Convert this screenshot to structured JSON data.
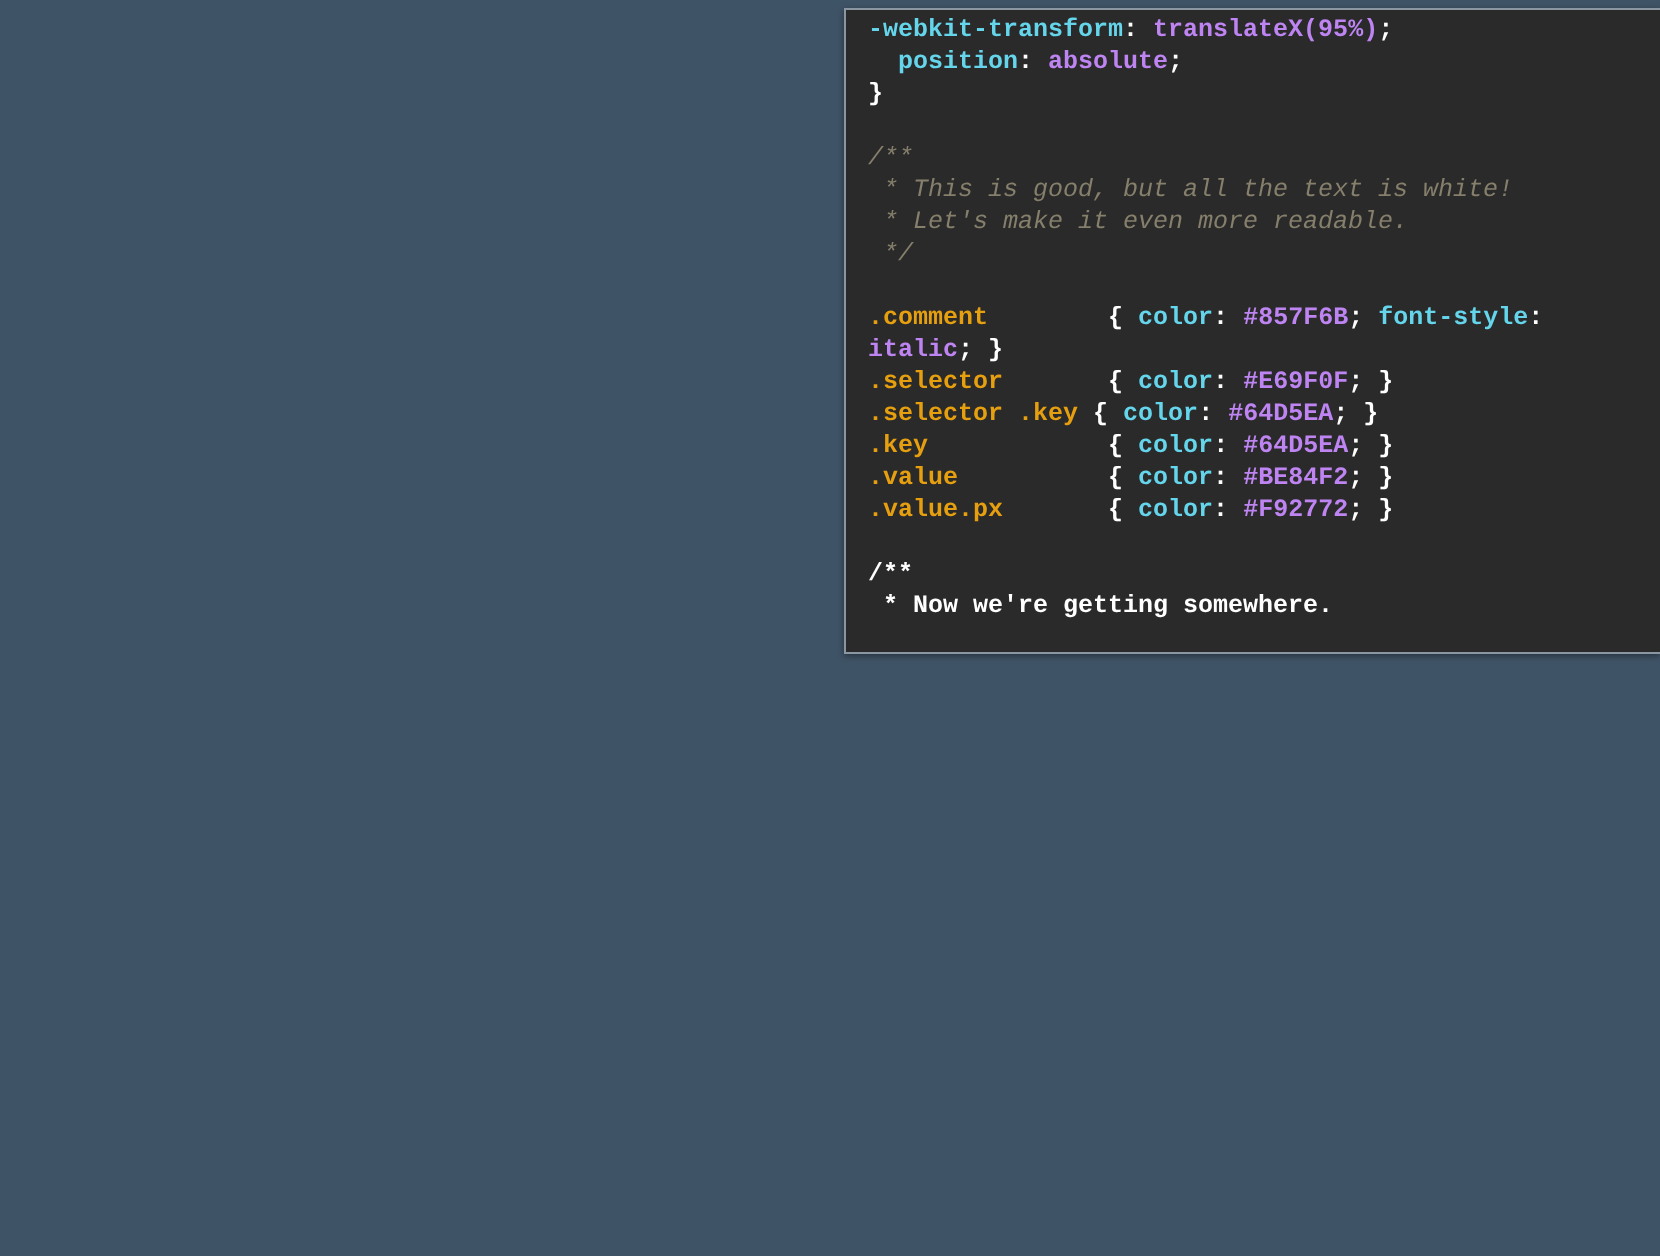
{
  "code_panel": {
    "lines": [
      {
        "blank_before": false,
        "tokens": [
          {
            "kind": "key",
            "text": "-webkit-transform"
          },
          {
            "kind": "plain",
            "text": ": "
          },
          {
            "kind": "value",
            "text": "translateX(95%)"
          },
          {
            "kind": "plain",
            "text": ";"
          }
        ]
      },
      {
        "blank_before": false,
        "tokens": [
          {
            "kind": "key",
            "text": "  position"
          },
          {
            "kind": "plain",
            "text": ": "
          },
          {
            "kind": "value",
            "text": "absolute"
          },
          {
            "kind": "plain",
            "text": ";"
          }
        ]
      },
      {
        "blank_before": false,
        "tokens": [
          {
            "kind": "plain",
            "text": "}"
          }
        ]
      },
      {
        "blank_before": true,
        "tokens": [
          {
            "kind": "comment",
            "text": "/**"
          }
        ]
      },
      {
        "blank_before": false,
        "tokens": [
          {
            "kind": "comment",
            "text": " * This is good, but all the text is white!"
          }
        ]
      },
      {
        "blank_before": false,
        "tokens": [
          {
            "kind": "comment",
            "text": " * Let's make it even more readable."
          }
        ]
      },
      {
        "blank_before": false,
        "tokens": [
          {
            "kind": "comment",
            "text": " */"
          }
        ]
      },
      {
        "blank_before": true,
        "tokens": [
          {
            "kind": "selector",
            "text": ".comment"
          },
          {
            "kind": "plain",
            "text": "        { "
          },
          {
            "kind": "key",
            "text": "color"
          },
          {
            "kind": "plain",
            "text": ": "
          },
          {
            "kind": "value",
            "text": "#857F6B"
          },
          {
            "kind": "plain",
            "text": "; "
          },
          {
            "kind": "key",
            "text": "font-style"
          },
          {
            "kind": "plain",
            "text": ":"
          }
        ]
      },
      {
        "blank_before": false,
        "tokens": [
          {
            "kind": "value",
            "text": "italic"
          },
          {
            "kind": "plain",
            "text": "; }"
          }
        ]
      },
      {
        "blank_before": false,
        "tokens": [
          {
            "kind": "selector",
            "text": ".selector"
          },
          {
            "kind": "plain",
            "text": "       { "
          },
          {
            "kind": "key",
            "text": "color"
          },
          {
            "kind": "plain",
            "text": ": "
          },
          {
            "kind": "value",
            "text": "#E69F0F"
          },
          {
            "kind": "plain",
            "text": "; }"
          }
        ]
      },
      {
        "blank_before": false,
        "tokens": [
          {
            "kind": "selector",
            "text": ".selector .key"
          },
          {
            "kind": "plain",
            "text": " { "
          },
          {
            "kind": "key",
            "text": "color"
          },
          {
            "kind": "plain",
            "text": ": "
          },
          {
            "kind": "value",
            "text": "#64D5EA"
          },
          {
            "kind": "plain",
            "text": "; }"
          }
        ]
      },
      {
        "blank_before": false,
        "tokens": [
          {
            "kind": "selector",
            "text": ".key"
          },
          {
            "kind": "plain",
            "text": "            { "
          },
          {
            "kind": "key",
            "text": "color"
          },
          {
            "kind": "plain",
            "text": ": "
          },
          {
            "kind": "value",
            "text": "#64D5EA"
          },
          {
            "kind": "plain",
            "text": "; }"
          }
        ]
      },
      {
        "blank_before": false,
        "tokens": [
          {
            "kind": "selector",
            "text": ".value"
          },
          {
            "kind": "plain",
            "text": "          { "
          },
          {
            "kind": "key",
            "text": "color"
          },
          {
            "kind": "plain",
            "text": ": "
          },
          {
            "kind": "value",
            "text": "#BE84F2"
          },
          {
            "kind": "plain",
            "text": "; }"
          }
        ]
      },
      {
        "blank_before": false,
        "tokens": [
          {
            "kind": "selector",
            "text": ".value.px"
          },
          {
            "kind": "plain",
            "text": "       { "
          },
          {
            "kind": "key",
            "text": "color"
          },
          {
            "kind": "plain",
            "text": ": "
          },
          {
            "kind": "value",
            "text": "#F92772"
          },
          {
            "kind": "plain",
            "text": "; }"
          }
        ]
      },
      {
        "blank_before": true,
        "tokens": [
          {
            "kind": "plain",
            "text": "/**"
          }
        ]
      },
      {
        "blank_before": false,
        "tokens": [
          {
            "kind": "plain",
            "text": " * Now we're getting somewhere."
          }
        ]
      }
    ]
  }
}
